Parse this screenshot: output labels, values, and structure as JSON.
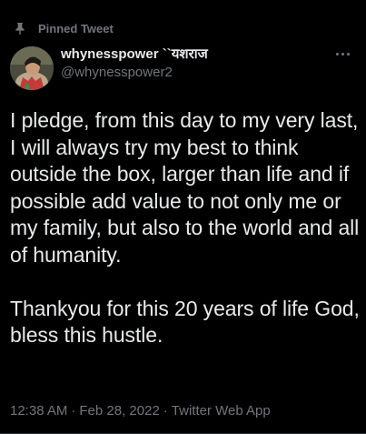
{
  "pinned": {
    "label": "Pinned Tweet",
    "icon": "pin-icon"
  },
  "author": {
    "display_name": "whynesspower ``यशराज",
    "handle": "@whynesspower2",
    "avatar": "avatar"
  },
  "more_icon": "more-horizontal-icon",
  "tweet": {
    "text": "I pledge, from this day to my very last, I will always try my best to think outside the box, larger than life and if possible add value to not only me or my family, but also to the world and all of humanity.\n\nThankyou for this 20 years of life God, bless this hustle."
  },
  "meta": {
    "time": "12:38 AM",
    "separator": "·",
    "date": "Feb 28, 2022",
    "source": "Twitter Web App"
  },
  "colors": {
    "background": "#000000",
    "text": "#e7e9ea",
    "secondary": "#71767b"
  }
}
